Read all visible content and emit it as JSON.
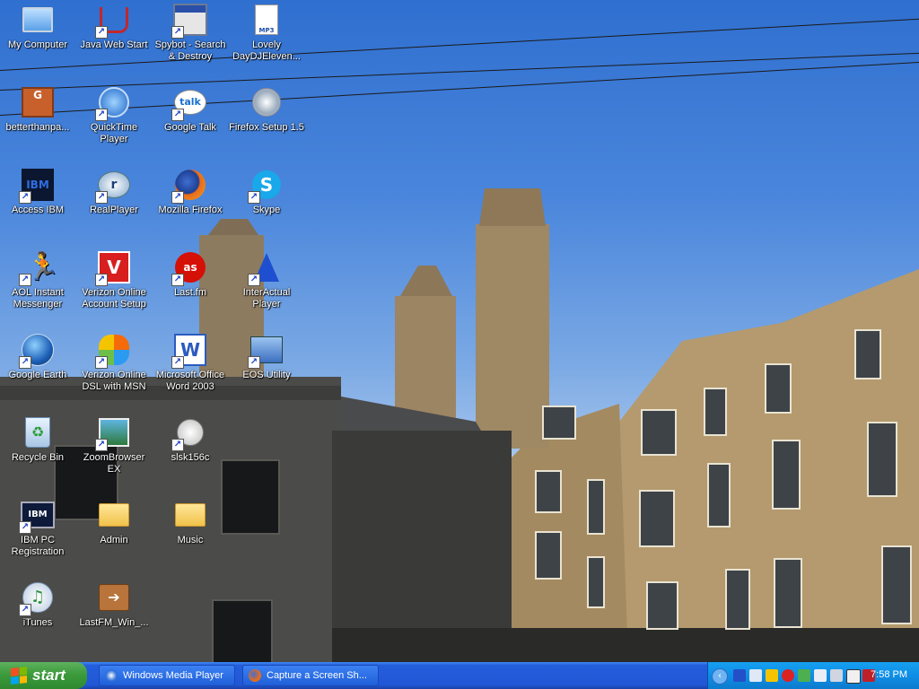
{
  "desktop_icons": [
    {
      "label": "My Computer",
      "icon": "computer-icon",
      "shortcut": false
    },
    {
      "label": "Java Web Start",
      "icon": "java-icon",
      "shortcut": true
    },
    {
      "label": "Spybot - Search & Destroy",
      "icon": "spybot-icon",
      "shortcut": true
    },
    {
      "label": "Lovely DayDJEleven...",
      "icon": "mp3-file-icon",
      "shortcut": false
    },
    {
      "label": "betterthanpa...",
      "icon": "zip-archive-icon",
      "shortcut": false
    },
    {
      "label": "QuickTime Player",
      "icon": "quicktime-icon",
      "shortcut": true
    },
    {
      "label": "Google Talk",
      "icon": "google-talk-icon",
      "shortcut": true
    },
    {
      "label": "Firefox Setup 1.5",
      "icon": "installer-icon",
      "shortcut": false
    },
    {
      "label": "Access IBM",
      "icon": "ibm-icon",
      "shortcut": true
    },
    {
      "label": "RealPlayer",
      "icon": "realplayer-icon",
      "shortcut": true
    },
    {
      "label": "Mozilla Firefox",
      "icon": "firefox-icon",
      "shortcut": true
    },
    {
      "label": "Skype",
      "icon": "skype-icon",
      "shortcut": true
    },
    {
      "label": "AOL Instant Messenger",
      "icon": "aim-icon",
      "shortcut": true
    },
    {
      "label": "Verizon Online Account Setup",
      "icon": "verizon-icon",
      "shortcut": true
    },
    {
      "label": "Last.fm",
      "icon": "lastfm-icon",
      "shortcut": true
    },
    {
      "label": "InterActual Player",
      "icon": "interactual-icon",
      "shortcut": true
    },
    {
      "label": "Google Earth",
      "icon": "google-earth-icon",
      "shortcut": true
    },
    {
      "label": "Verizon Online DSL with MSN",
      "icon": "msn-butterfly-icon",
      "shortcut": true
    },
    {
      "label": "Microsoft Office Word 2003",
      "icon": "word-icon",
      "shortcut": true
    },
    {
      "label": "EOS Utility",
      "icon": "eos-utility-icon",
      "shortcut": true
    },
    {
      "label": "Recycle Bin",
      "icon": "recycle-bin-icon",
      "shortcut": false
    },
    {
      "label": "ZoomBrowser EX",
      "icon": "zoombrowser-icon",
      "shortcut": true
    },
    {
      "label": "slsk156c",
      "icon": "soulseek-icon",
      "shortcut": true
    },
    {
      "label": "IBM PC Registration",
      "icon": "ibm-registration-icon",
      "shortcut": true
    },
    {
      "label": "Admin",
      "icon": "folder-icon",
      "shortcut": false
    },
    {
      "label": "Music",
      "icon": "folder-icon",
      "shortcut": false
    },
    {
      "label": "iTunes",
      "icon": "itunes-icon",
      "shortcut": true
    },
    {
      "label": "LastFM_Win_...",
      "icon": "lastfm-installer-icon",
      "shortcut": false
    }
  ],
  "taskbar": {
    "start_label": "start",
    "tasks": [
      {
        "label": "Windows Media Player",
        "icon": "media-player-icon"
      },
      {
        "label": "Capture a Screen Sh...",
        "icon": "firefox-icon"
      }
    ],
    "tray_icons": [
      "bluetooth-icon",
      "network-icon",
      "aim-tray-icon",
      "stop-icon",
      "security-icon",
      "ibm-tray-icon",
      "speaker-icon",
      "access-connections-icon",
      "shield-icon"
    ],
    "clock": "7:58 PM"
  }
}
